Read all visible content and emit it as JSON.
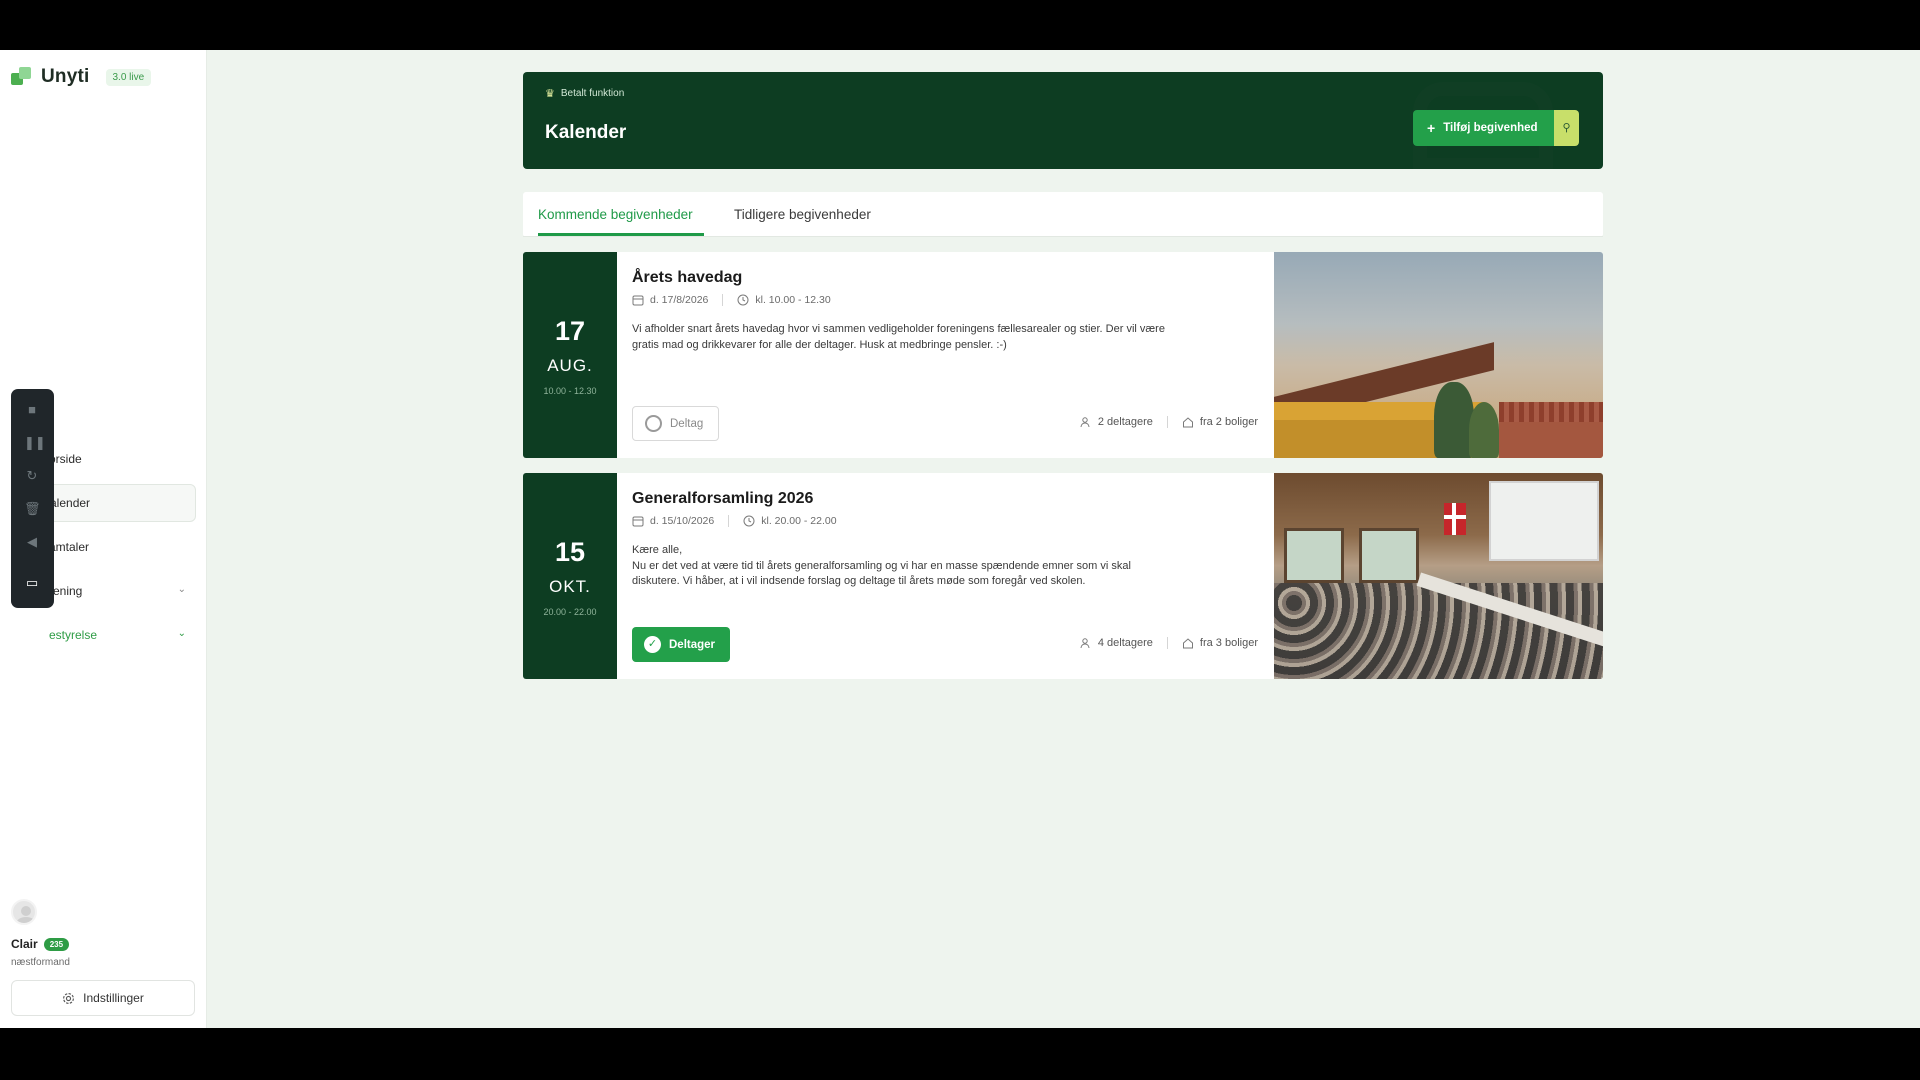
{
  "app": {
    "brand": "Unyti",
    "version_badge": "3.0 live"
  },
  "sidebar": {
    "items": [
      {
        "label": "orside",
        "active": false,
        "has_chevron": false
      },
      {
        "label": "alender",
        "active": true,
        "has_chevron": false
      },
      {
        "label": "amtaler",
        "active": false,
        "has_chevron": false
      },
      {
        "label": "rening",
        "active": false,
        "has_chevron": true
      },
      {
        "label": "estyrelse",
        "active": false,
        "has_chevron": true,
        "highlight": true
      }
    ],
    "user": {
      "name": "Clair",
      "badge": "235",
      "role": "næstformand"
    },
    "settings_label": "Indstillinger"
  },
  "header": {
    "paid_label": "Betalt funktion",
    "title": "Kalender",
    "add_button": "Tilføj begivenhed"
  },
  "tabs": [
    {
      "label": "Kommende begivenheder",
      "active": true
    },
    {
      "label": "Tidligere begivenheder",
      "active": false
    }
  ],
  "events": [
    {
      "day": "17",
      "month": "AUG.",
      "time_range": "10.00 - 12.30",
      "title": "Årets havedag",
      "date": "d. 17/8/2026",
      "time": "kl. 10.00  -  12.30",
      "description": "Vi afholder snart årets havedag hvor vi sammen vedligeholder foreningens fællesarealer og stier. Der vil være gratis mad og drikkevarer for alle der deltager. Husk at medbringe pensler. :-)",
      "join_label": "Deltag",
      "joined": false,
      "participants": "2 deltagere",
      "households": "fra 2 boliger"
    },
    {
      "day": "15",
      "month": "OKT.",
      "time_range": "20.00 - 22.00",
      "title": "Generalforsamling 2026",
      "date": "d. 15/10/2026",
      "time": "kl. 20.00  -  22.00",
      "description": "Kære alle,\nNu er det ved at være tid til årets generalforsamling og vi har en masse spændende emner som vi skal diskutere. Vi håber, at i vil indsende forslag og deltage til årets møde som foregår ved skolen.",
      "join_label": "Deltager",
      "joined": true,
      "participants": "4 deltagere",
      "households": "fra 3 boliger"
    }
  ],
  "colors": {
    "accent": "#23a04a",
    "dark_green": "#0d3d22",
    "background": "#eef4ee"
  }
}
